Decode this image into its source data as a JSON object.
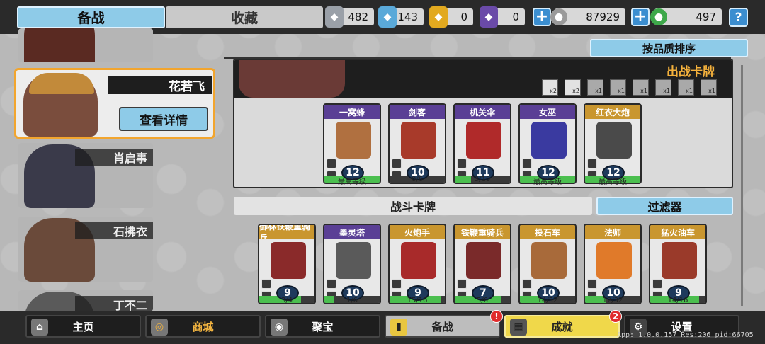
{
  "tabs": {
    "prep": "备战",
    "collection": "收藏"
  },
  "resources": [
    {
      "icon": "silver-shield-icon",
      "value": "482",
      "color": "#9aa0a8"
    },
    {
      "icon": "blue-crystal-icon",
      "value": "143",
      "color": "#5aa9d9"
    },
    {
      "icon": "gold-badge-icon",
      "value": "0",
      "color": "#e2a91f"
    },
    {
      "icon": "purple-badge-icon",
      "value": "0",
      "color": "#6a4aa8"
    },
    {
      "icon": "silver-coin-icon",
      "value": "87929",
      "color": "#9a9a9a"
    },
    {
      "icon": "green-gem-icon",
      "value": "497",
      "color": "#3ea84a"
    }
  ],
  "help": "?",
  "heroes": [
    {
      "name": ""
    },
    {
      "name": "花若飞",
      "selected": true,
      "detail": "查看详情"
    },
    {
      "name": "肖启事"
    },
    {
      "name": "石拂衣"
    },
    {
      "name": "丁不二"
    }
  ],
  "sort_button": "按品质排序",
  "deploy": {
    "title": "出战卡牌",
    "filters": [
      "x2",
      "x2",
      "x1",
      "x1",
      "x1",
      "x1",
      "x1",
      "x1"
    ],
    "cards": [
      {
        "name": "一窝蜂",
        "level": "12",
        "sub": "最高等级",
        "quality": "purple",
        "fill": 1.0,
        "color": "#b07040"
      },
      {
        "name": "剑客",
        "level": "10",
        "sub": "0/6",
        "quality": "purple",
        "fill": 0.0,
        "color": "#a83a2a"
      },
      {
        "name": "机关伞",
        "level": "11",
        "sub": "3/10",
        "quality": "purple",
        "fill": 0.3,
        "color": "#b02a2a"
      },
      {
        "name": "女巫",
        "level": "12",
        "sub": "最高等级",
        "quality": "purple",
        "fill": 1.0,
        "color": "#3a3aa0"
      },
      {
        "name": "红衣大炮",
        "level": "12",
        "sub": "最高等级",
        "quality": "gold",
        "fill": 1.0,
        "color": "#4a4a4a"
      }
    ]
  },
  "battle_cards_label": "战斗卡牌",
  "filter_label": "过滤器",
  "battle_cards": [
    {
      "name": "御林铁鞭重骑兵",
      "level": "9",
      "sub": "3/4",
      "quality": "gold",
      "fill": 0.75,
      "color": "#8a2a2a"
    },
    {
      "name": "墨灵塔",
      "level": "10",
      "sub": "1/6",
      "quality": "purple",
      "fill": 0.17,
      "color": "#5a5a5a"
    },
    {
      "name": "火炮手",
      "level": "9",
      "sub": "15/16",
      "quality": "gold",
      "fill": 0.94,
      "color": "#a82a2a"
    },
    {
      "name": "铁鞭重骑兵",
      "level": "7",
      "sub": "5/6",
      "quality": "gold",
      "fill": 0.83,
      "color": "#7a2a2a"
    },
    {
      "name": "投石车",
      "level": "10",
      "sub": "14/32",
      "quality": "gold",
      "fill": 0.44,
      "color": "#a86a3a"
    },
    {
      "name": "法师",
      "level": "10",
      "sub": "12/32",
      "quality": "gold",
      "fill": 0.38,
      "color": "#e07a2a"
    },
    {
      "name": "猛火油车",
      "level": "9",
      "sub": "14/16",
      "quality": "gold",
      "fill": 0.88,
      "color": "#9a3a2a"
    }
  ],
  "nav": [
    {
      "label": "主页",
      "icon": "home-icon"
    },
    {
      "label": "商城",
      "icon": "coins-icon"
    },
    {
      "label": "聚宝",
      "icon": "treasure-icon"
    },
    {
      "label": "备战",
      "icon": "card-icon",
      "badge": "!"
    },
    {
      "label": "成就",
      "icon": "achievement-icon",
      "badge": "2"
    },
    {
      "label": "设置",
      "icon": "gear-icon"
    }
  ],
  "app_info": "App: 1.0.0.157 Res:206 pid:66705"
}
